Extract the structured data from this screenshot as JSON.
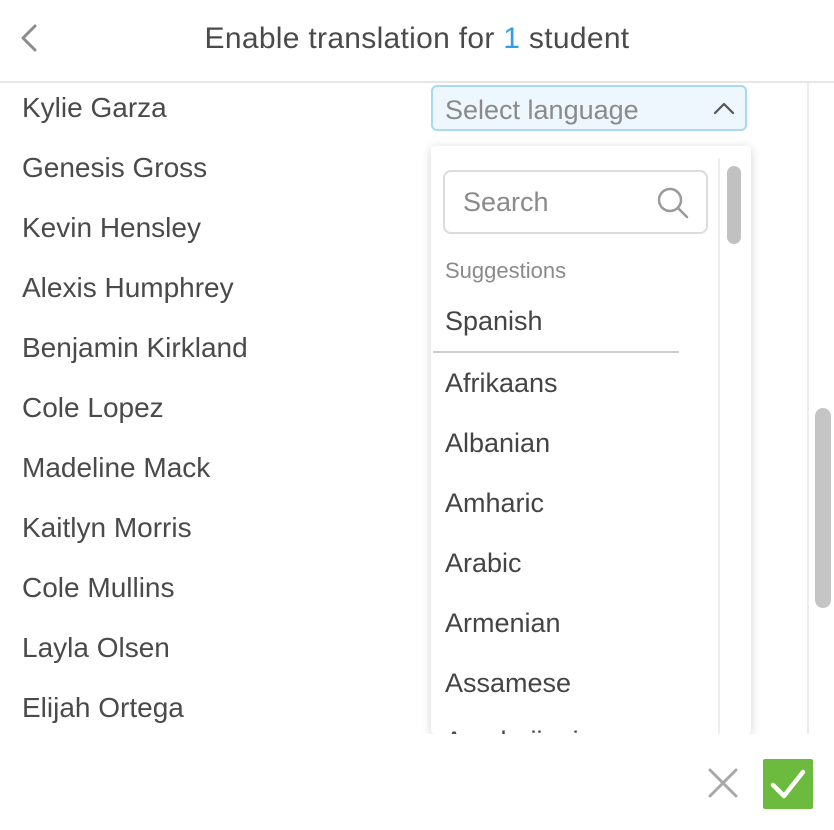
{
  "header": {
    "title_prefix": "Enable translation for ",
    "title_count": "1",
    "title_suffix": " student"
  },
  "students": [
    "Kylie Garza",
    "Genesis Gross",
    "Kevin Hensley",
    "Alexis Humphrey",
    "Benjamin Kirkland",
    "Cole Lopez",
    "Madeline Mack",
    "Kaitlyn Morris",
    "Cole Mullins",
    "Layla Olsen",
    "Elijah Ortega"
  ],
  "language_select": {
    "placeholder": "Select language"
  },
  "dropdown": {
    "search_placeholder": "Search",
    "suggestions_label": "Suggestions",
    "suggestions": [
      "Spanish"
    ],
    "languages": [
      "Afrikaans",
      "Albanian",
      "Amharic",
      "Arabic",
      "Armenian",
      "Assamese",
      "Azerbaijani"
    ]
  },
  "colors": {
    "accent": "#2f9fe8",
    "confirm": "#6dbb3e",
    "select_border": "#a9d8f3",
    "select_bg": "#eef7fd"
  },
  "icons": {
    "back": "chevron-left-icon",
    "select_toggle": "chevron-up-icon",
    "search": "search-icon",
    "cancel": "close-icon",
    "confirm": "check-icon"
  }
}
